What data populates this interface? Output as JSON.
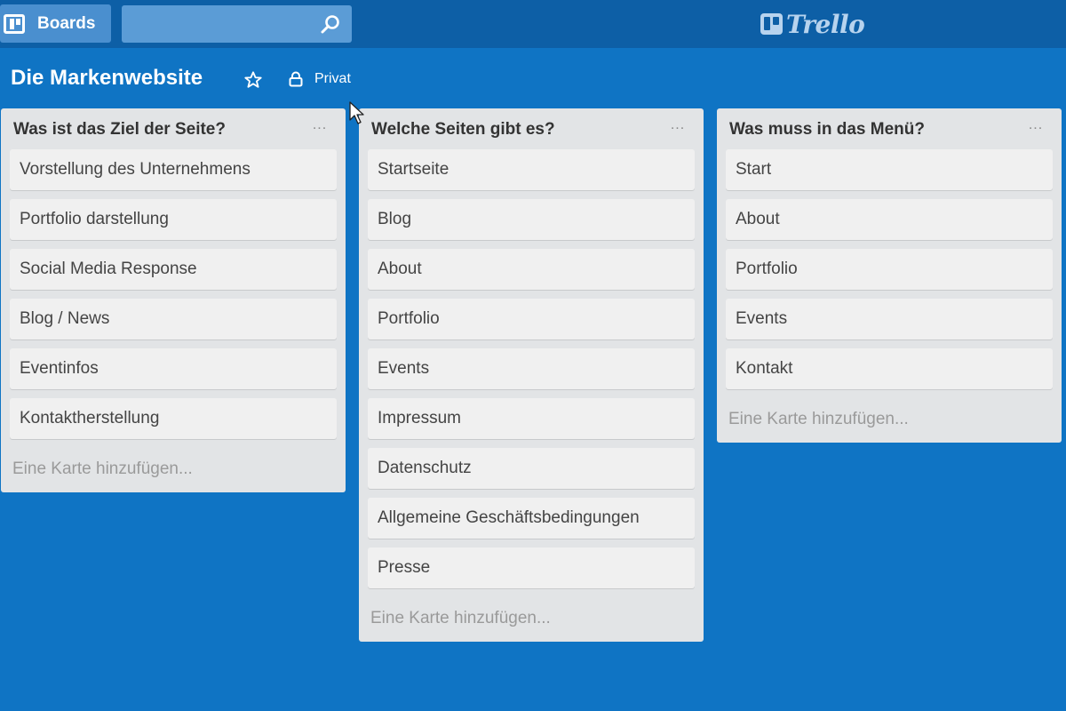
{
  "header": {
    "boards_label": "Boards",
    "search": {
      "value": "",
      "placeholder": ""
    },
    "logo_text": "Trello"
  },
  "board": {
    "title": "Die Markenwebsite",
    "privacy_label": "Privat"
  },
  "lists": [
    {
      "title": "Was ist das Ziel der Seite?",
      "menu": "...",
      "cards": [
        "Vorstellung des Unternehmens",
        "Portfolio darstellung",
        "Social Media Response",
        "Blog / News",
        "Eventinfos",
        "Kontaktherstellung"
      ],
      "add_card": "Eine Karte hinzufügen..."
    },
    {
      "title": "Welche Seiten gibt es?",
      "menu": "...",
      "cards": [
        "Startseite",
        "Blog",
        "About",
        "Portfolio",
        "Events",
        "Impressum",
        "Datenschutz",
        "Allgemeine Geschäftsbedingungen",
        "Presse"
      ],
      "add_card": "Eine Karte hinzufügen..."
    },
    {
      "title": "Was muss in das Menü?",
      "menu": "...",
      "cards": [
        "Start",
        "About",
        "Portfolio",
        "Events",
        "Kontakt"
      ],
      "add_card": "Eine Karte hinzufügen..."
    }
  ],
  "icons": {
    "boards": "boards-icon",
    "search": "search-icon",
    "star": "star-icon",
    "lock": "lock-icon",
    "cursor": "mouse-cursor-icon"
  },
  "colors": {
    "background": "#0f74c4",
    "header": "#0d5fa6",
    "list": "#e2e4e6",
    "card": "#f0f0f0"
  }
}
